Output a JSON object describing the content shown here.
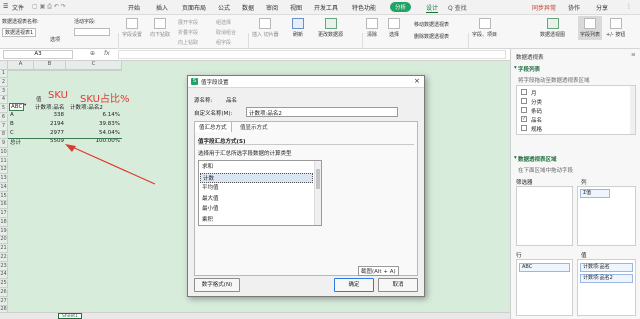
{
  "colors": {
    "accent_green": "#1d6f3d",
    "pill_green": "#21a366",
    "pill_blue": "#2f7be5",
    "annotation_red": "#e03a2f",
    "grid_bg": "#d8ecdc"
  },
  "menubar": {
    "file_label": "文件",
    "tabs": [
      "开始",
      "插入",
      "页面布局",
      "公式",
      "数据",
      "审阅",
      "视图",
      "开发工具",
      "特色功能"
    ],
    "analyze_label": "分析",
    "design_label": "设计",
    "search_placeholder": "Q 查找",
    "sync_label": "同步异常",
    "collab_label": "协作",
    "share_label": "分享"
  },
  "ribbon": {
    "pivot_name_label": "数据透视表名称:",
    "pivot_name_value": "数据透视表1",
    "options_label": "选项",
    "active_field_label": "活动字段:",
    "field_settings_label": "字段设置",
    "drill_down_label": "向下钻取",
    "drill_up_label": "向上钻取",
    "expand_label": "展开字段",
    "collapse_label": "折叠字段",
    "group_selection_label": "组选择",
    "ungroup_label": "取消组合",
    "group_field_label": "组字段",
    "insert_slicer_label": "插入 切片器",
    "refresh_label": "刷新",
    "change_source_label": "更改数据源",
    "clear_label": "清除",
    "select_label": "选择",
    "move_pivot_label": "移动数据透视表",
    "delete_pivot_label": "删除数据透视表",
    "fields_items_label": "字段、项目",
    "pivot_chart_label": "数据透视图",
    "field_list_label": "字段列表",
    "buttons_label": "+/- 按钮"
  },
  "formula_bar": {
    "cell_ref": "A3",
    "fx": "fx"
  },
  "sheet": {
    "columns": [
      "A",
      "B",
      "C"
    ],
    "rows": [
      "1",
      "2",
      "3",
      "4",
      "5",
      "6",
      "7",
      "8",
      "9",
      "10",
      "11",
      "12",
      "13",
      "14",
      "15",
      "16",
      "17",
      "18",
      "19",
      "20",
      "21",
      "22",
      "23",
      "24",
      "25",
      "26",
      "27",
      "28"
    ],
    "header_values": "值",
    "row_label_header": "ABC",
    "col_b_header": "计数项:品名",
    "col_c_header": "计数项:品名2",
    "data_rows": [
      {
        "label": "A",
        "count": "338",
        "pct": "6.14%"
      },
      {
        "label": "B",
        "count": "2194",
        "pct": "39.83%"
      },
      {
        "label": "C",
        "count": "2977",
        "pct": "54.04%"
      },
      {
        "label": "总计",
        "count": "5509",
        "pct": "100.00%"
      }
    ],
    "annotation_sku": "SKU",
    "annotation_pct": "SKU占比%",
    "sheet_tab": "Sheet1"
  },
  "dialog": {
    "title": "值字段设置",
    "source_name_label": "源名称:",
    "source_name_value": "品名",
    "custom_name_label": "自定义名称(M):",
    "custom_name_value": "计数项:品名2",
    "tabs": [
      "值汇总方式",
      "值显示方式"
    ],
    "section_title": "值字段汇总方式(S)",
    "section_desc": "选择用于汇总所选字段数据的计算类型",
    "list_items": [
      "求和",
      "计数",
      "平均值",
      "最大值",
      "最小值",
      "乘积"
    ],
    "selected_index": 1,
    "tooltip": "截图(Alt + A)",
    "number_format_label": "数字格式(N)",
    "ok_label": "确定",
    "cancel_label": "取消"
  },
  "pane": {
    "title": "数据透视表",
    "field_list_title": "字段列表",
    "field_list_desc": "将字段拖动至数据透视表区域",
    "fields": [
      {
        "label": "月",
        "checked": false
      },
      {
        "label": "分类",
        "checked": false
      },
      {
        "label": "条码",
        "checked": false
      },
      {
        "label": "品名",
        "checked": true
      },
      {
        "label": "规格",
        "checked": false
      }
    ],
    "areas_title": "数据透视表区域",
    "areas_desc": "在下面区域中拖动字段",
    "filter_label": "筛选器",
    "columns_label": "列",
    "columns_chip": "Σ值",
    "rows_label": "行",
    "values_label": "值",
    "rows_chip": "ABC",
    "values_chips": [
      "计数项:品名",
      "计数项:品名2"
    ]
  }
}
